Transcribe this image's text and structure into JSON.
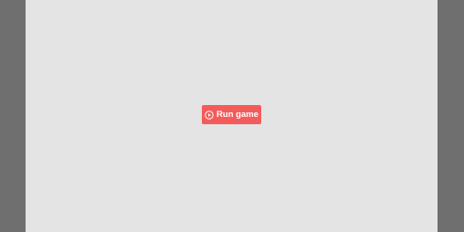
{
  "game": {
    "run_label": "Run game",
    "icon": "play-circle-icon"
  },
  "colors": {
    "backdrop": "#6f6f6f",
    "stage": "#e4e4e4",
    "button": "#f45c5c",
    "button_text": "#ffffff"
  }
}
